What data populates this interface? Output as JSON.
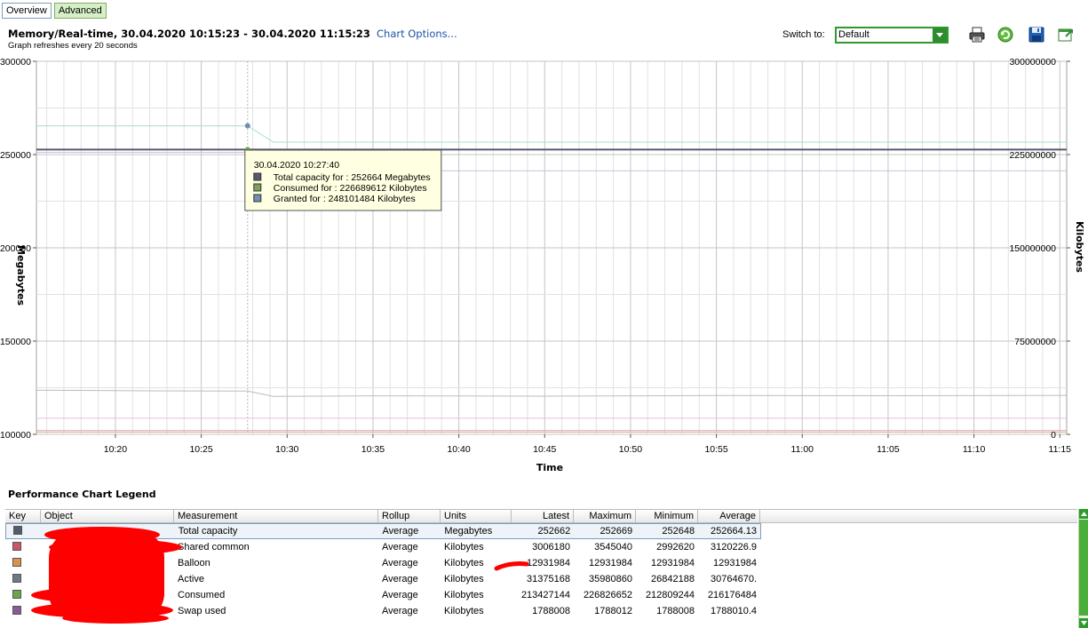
{
  "tabs": [
    {
      "label": "Overview",
      "active": false
    },
    {
      "label": "Advanced",
      "active": true
    }
  ],
  "header": {
    "title": "Memory/Real-time, 30.04.2020 10:15:23 - 30.04.2020 11:15:23",
    "chart_options_link": "Chart Options...",
    "subtitle": "Graph refreshes every 20 seconds"
  },
  "switch_to": {
    "label": "Switch to:",
    "selected": "Default"
  },
  "toolbar": {
    "icons": [
      "print-icon",
      "refresh-icon",
      "save-icon",
      "export-icon"
    ]
  },
  "chart_data": {
    "type": "line",
    "xlabel": "Time",
    "ylabel_left": "Megabytes",
    "ylabel_right": "Kilobytes",
    "ylim_left": [
      100000,
      300000
    ],
    "ylim_right": [
      0,
      300000000
    ],
    "yticks_left": [
      "300000",
      "250000",
      "200000",
      "150000",
      "100000"
    ],
    "yticks_right": [
      "300000000",
      "225000000",
      "150000000",
      "75000000",
      "0"
    ],
    "xticks": [
      "10:20",
      "10:25",
      "10:30",
      "10:35",
      "10:40",
      "10:45",
      "10:50",
      "10:55",
      "11:00",
      "11:05",
      "11:10",
      "11:15"
    ],
    "grid": true,
    "series": [
      {
        "name": "Total capacity",
        "axis": "left",
        "color": "#555a6e",
        "x_minutes": [
          15.4,
          27.7,
          75.4
        ],
        "values": [
          252664,
          252664,
          252662
        ]
      },
      {
        "name": "Granted",
        "axis": "right",
        "color": "#a9dcd6",
        "x_minutes": [
          15.4,
          27.7,
          29.2,
          75.4
        ],
        "values": [
          248101484,
          248101484,
          235000000,
          235000000
        ]
      },
      {
        "name": "Consumed",
        "axis": "right",
        "color": "#c8c0dc",
        "x_minutes": [
          15.4,
          27.7,
          29.2,
          75.4
        ],
        "values": [
          226689612,
          226689612,
          212000000,
          212000000
        ]
      },
      {
        "name": "Active",
        "axis": "right",
        "color": "#bdbdbd",
        "x_minutes": [
          15.4,
          22,
          27.7,
          29.2,
          35,
          45,
          55,
          65,
          75.4
        ],
        "values": [
          35500000,
          35000000,
          34800000,
          30500000,
          31000000,
          30700000,
          31200000,
          31100000,
          31375168
        ]
      },
      {
        "name": "Shared common",
        "axis": "right",
        "color": "#d9a0b4",
        "x_minutes": [
          15.4,
          75.4
        ],
        "values": [
          3006180,
          3006180
        ]
      },
      {
        "name": "Balloon",
        "axis": "right",
        "color": "#e0c0e0",
        "x_minutes": [
          15.4,
          75.4
        ],
        "values": [
          12931984,
          12931984
        ]
      },
      {
        "name": "Swap used",
        "axis": "right",
        "color": "#d8b890",
        "x_minutes": [
          15.4,
          75.4
        ],
        "values": [
          1788008,
          1788008
        ]
      }
    ],
    "tooltip": {
      "time": "30.04.2020 10:27:40",
      "x_minute": 27.7,
      "lines": [
        {
          "text": "Total capacity for : 252664 Megabytes",
          "color": "#555a6e"
        },
        {
          "text": "Consumed for : 226689612 Kilobytes",
          "color": "#7fa05a"
        },
        {
          "text": "Granted for : 248101484 Kilobytes",
          "color": "#6f8fb4"
        }
      ]
    }
  },
  "legend": {
    "title": "Performance Chart Legend",
    "columns": [
      "Key",
      "Object",
      "Measurement",
      "Rollup",
      "Units",
      "Latest",
      "Maximum",
      "Minimum",
      "Average"
    ],
    "rows": [
      {
        "key_color": "#555a6e",
        "measurement": "Total capacity",
        "rollup": "Average",
        "units": "Megabytes",
        "latest": "252662",
        "maximum": "252669",
        "minimum": "252648",
        "average": "252664.13"
      },
      {
        "key_color": "#c9566a",
        "measurement": "Shared common",
        "rollup": "Average",
        "units": "Kilobytes",
        "latest": "3006180",
        "maximum": "3545040",
        "minimum": "2992620",
        "average": "3120226.9"
      },
      {
        "key_color": "#d9944a",
        "measurement": "Balloon",
        "rollup": "Average",
        "units": "Kilobytes",
        "latest": "12931984",
        "maximum": "12931984",
        "minimum": "12931984",
        "average": "12931984"
      },
      {
        "key_color": "#6f7a84",
        "measurement": "Active",
        "rollup": "Average",
        "units": "Kilobytes",
        "latest": "31375168",
        "maximum": "35980860",
        "minimum": "26842188",
        "average": "30764670."
      },
      {
        "key_color": "#6aa64a",
        "measurement": "Consumed",
        "rollup": "Average",
        "units": "Kilobytes",
        "latest": "213427144",
        "maximum": "226826652",
        "minimum": "212809244",
        "average": "216176484"
      },
      {
        "key_color": "#8a5a9c",
        "measurement": "Swap used",
        "rollup": "Average",
        "units": "Kilobytes",
        "latest": "1788008",
        "maximum": "1788012",
        "minimum": "1788008",
        "average": "1788010.4"
      }
    ]
  }
}
